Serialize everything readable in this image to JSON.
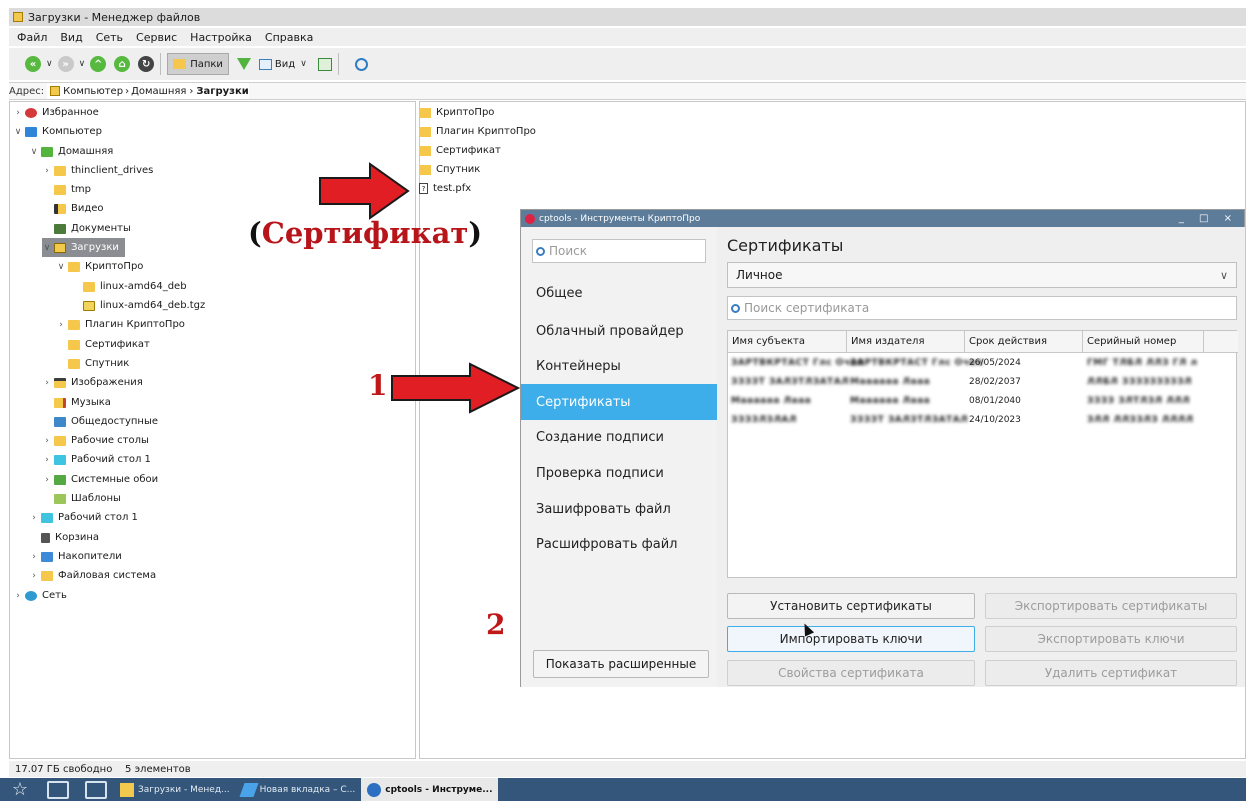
{
  "window_title": "Загрузки - Менеджер файлов",
  "menu": [
    "Файл",
    "Вид",
    "Сеть",
    "Сервис",
    "Настройка",
    "Справка"
  ],
  "toolbar": {
    "folders_label": "Папки",
    "view_label": "Вид"
  },
  "address": {
    "label": "Адрес:",
    "crumb1": "Компьютер",
    "crumb2": "Домашняя",
    "crumb3": "Загрузки"
  },
  "tree": [
    {
      "label": "Избранное",
      "icon": "heart-icon"
    },
    {
      "label": "Компьютер",
      "icon": "computer-icon"
    },
    {
      "label": "Домашняя",
      "icon": "home-icon"
    },
    {
      "label": "thinclient_drives",
      "icon": "folder-icon"
    },
    {
      "label": "tmp",
      "icon": "folder-icon"
    },
    {
      "label": "Видео",
      "icon": "video-folder-icon"
    },
    {
      "label": "Документы",
      "icon": "documents-folder-icon"
    },
    {
      "label": "Загрузки",
      "icon": "downloads-folder-icon"
    },
    {
      "label": "КриптоПро",
      "icon": "folder-icon"
    },
    {
      "label": "linux-amd64_deb",
      "icon": "folder-icon"
    },
    {
      "label": "linux-amd64_deb.tgz",
      "icon": "archive-icon"
    },
    {
      "label": "Плагин КриптоПро",
      "icon": "folder-icon"
    },
    {
      "label": "Сертификат",
      "icon": "folder-icon"
    },
    {
      "label": "Спутник",
      "icon": "folder-icon"
    },
    {
      "label": "Изображения",
      "icon": "images-folder-icon"
    },
    {
      "label": "Музыка",
      "icon": "music-folder-icon"
    },
    {
      "label": "Общедоступные",
      "icon": "public-folder-icon"
    },
    {
      "label": "Рабочие столы",
      "icon": "folder-icon"
    },
    {
      "label": "Рабочий стол 1",
      "icon": "desktop-folder-icon"
    },
    {
      "label": "Системные обои",
      "icon": "wallpaper-folder-icon"
    },
    {
      "label": "Шаблоны",
      "icon": "templates-folder-icon"
    },
    {
      "label": "Рабочий стол 1",
      "icon": "desktop-icon"
    },
    {
      "label": "Корзина",
      "icon": "trash-icon"
    },
    {
      "label": "Накопители",
      "icon": "drives-icon"
    },
    {
      "label": "Файловая система",
      "icon": "folder-icon"
    },
    {
      "label": "Сеть",
      "icon": "network-icon"
    }
  ],
  "files": [
    {
      "label": "КриптоПро"
    },
    {
      "label": "Плагин КриптоПро"
    },
    {
      "label": "Сертификат"
    },
    {
      "label": "Спутник"
    },
    {
      "label": "test.pfx"
    }
  ],
  "status": "17.07 ГБ свободно    5 элементов",
  "annotations": {
    "cert_open": "(",
    "cert_word": "Сертификат",
    "cert_close": ")",
    "step1": "1",
    "step2": "2"
  },
  "dialog": {
    "title": "cptools - Инструменты КриптоПро",
    "search_placeholder": "Поиск",
    "nav": [
      "Общее",
      "Облачный провайдер",
      "Контейнеры",
      "Сертификаты",
      "Создание подписи",
      "Проверка подписи",
      "Зашифровать файл",
      "Расшифровать файл"
    ],
    "show_advanced": "Показать расширенные",
    "heading": "Сертификаты",
    "store": "Личное",
    "cert_search_placeholder": "Поиск сертификата",
    "columns": [
      "Имя субъекта",
      "Имя издателя",
      "Срок действия",
      "Серийный номер"
    ],
    "rows": [
      {
        "subject": "ЗАРТВКРТАСТ Глс Очел",
        "issuer": "ЗАРТВКРТАСТ Глс Очел",
        "valid": "26/05/2024",
        "serial": "ГМГ ТЛБЛ ЛЛЗ ГЛ л"
      },
      {
        "subject": "ЗЗЗЗТ ЗАЛЗТЛЗАТАЛ",
        "issuer": "Маааааа Лааа",
        "valid": "28/02/2037",
        "serial": "ЛЛБЛ ЗЗЗЗЗЗЗЗЗЛ"
      },
      {
        "subject": "Маааааа Лааа",
        "issuer": "Маааааа Лааа",
        "valid": "08/01/2040",
        "serial": "ЗЗЗЗ ЗЛТЛЗЛ ЛЛЛ"
      },
      {
        "subject": "ЗЗЗЗЛЗЛАЛ",
        "issuer": "ЗЗЗЗТ ЗАЛЗТЛЗАТАЛ",
        "valid": "24/10/2023",
        "serial": "ЗЛЛ ЛЛЗЗЛЗ ЛЛЛЛ"
      }
    ],
    "btn_install": "Установить сертификаты",
    "btn_export_certs": "Экспортировать сертификаты",
    "btn_import_keys": "Импортировать ключи",
    "btn_export_keys": "Экспортировать ключи",
    "btn_properties": "Свойства сертификата",
    "btn_delete": "Удалить сертификат"
  },
  "taskbar": {
    "task1": "Загрузки - Менед...",
    "task2": "Новая вкладка – С...",
    "task3": "cptools - Инструме..."
  },
  "colors": {
    "selection": "#3daee9",
    "arrow": "#e01e24",
    "annotation_text": "#b8151a",
    "taskbar": "#33567a"
  }
}
